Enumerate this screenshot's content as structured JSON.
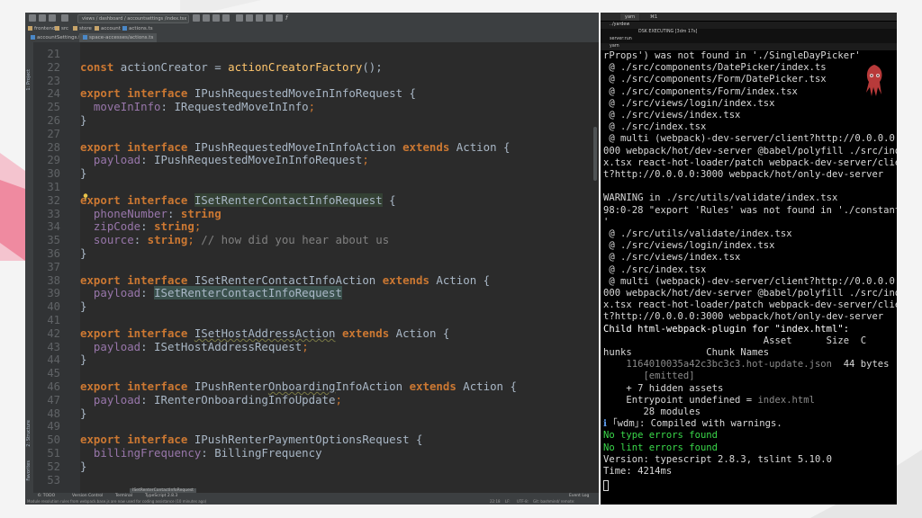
{
  "ide": {
    "toolbar_path": "views / dashboard / accountsettings /index.tsx",
    "breadcrumbs": [
      "frontend",
      "src",
      "store",
      "account",
      "actions.ts"
    ],
    "tabs": [
      "accountSettings.ts",
      "space-accesses/actions.ts"
    ],
    "side_tools": [
      "1: Project",
      "2: Structure",
      "Favorites"
    ],
    "gutter_start": 21,
    "status_top": "ISetRenterContactInfoRequest",
    "bottom_tools": [
      "6: TODO",
      "Version Control",
      "Terminal",
      "TypeScript 2.8.3"
    ],
    "event_log": "Event Log",
    "status_text": "Module resolution rules from webpack.base.js are now used for coding assistance (10 minutes ago)",
    "cursor_pos": "22:18",
    "line_sep": "LF:",
    "encoding": "UTF-8:",
    "git": "Git: bashmind/ remote:"
  },
  "code_lines": [
    [],
    [
      {
        "t": "const ",
        "c": "kw"
      },
      {
        "t": "actionCreator = "
      },
      {
        "t": "actionCreatorFactory",
        "c": "fn"
      },
      {
        "t": "();"
      }
    ],
    [],
    [
      {
        "t": "export ",
        "c": "kw"
      },
      {
        "t": "interface ",
        "c": "kw"
      },
      {
        "t": "IPushRequestedMoveInInfoRequest {"
      }
    ],
    [
      {
        "t": "  "
      },
      {
        "t": "moveInInfo",
        "c": "fld"
      },
      {
        "t": ": IRequestedMoveInInfo"
      },
      {
        "t": ";",
        "c": "punct"
      }
    ],
    [
      {
        "t": "}"
      }
    ],
    [],
    [
      {
        "t": "export ",
        "c": "kw"
      },
      {
        "t": "interface ",
        "c": "kw"
      },
      {
        "t": "IPushRequestedMoveInInfoAction "
      },
      {
        "t": "extends ",
        "c": "kw"
      },
      {
        "t": "Action {"
      }
    ],
    [
      {
        "t": "  "
      },
      {
        "t": "payload",
        "c": "fld"
      },
      {
        "t": ": IPushRequestedMoveInInfoRequest"
      },
      {
        "t": ";",
        "c": "punct"
      }
    ],
    [
      {
        "t": "}"
      }
    ],
    [],
    [
      {
        "t": "export ",
        "c": "kw"
      },
      {
        "t": "interface ",
        "c": "kw"
      },
      {
        "t": "ISetRenterContactInfoRequest",
        "c": "hl"
      },
      {
        "t": " {"
      }
    ],
    [
      {
        "t": "  "
      },
      {
        "t": "phoneNumber",
        "c": "fld"
      },
      {
        "t": ": "
      },
      {
        "t": "string",
        "c": "kw"
      }
    ],
    [
      {
        "t": "  "
      },
      {
        "t": "zipCode",
        "c": "fld"
      },
      {
        "t": ": "
      },
      {
        "t": "string",
        "c": "kw"
      },
      {
        "t": ";",
        "c": "punct"
      }
    ],
    [
      {
        "t": "  "
      },
      {
        "t": "source",
        "c": "fld"
      },
      {
        "t": ": "
      },
      {
        "t": "string",
        "c": "kw"
      },
      {
        "t": "; ",
        "c": "punct"
      },
      {
        "t": "// how did you hear about us",
        "c": "cm"
      }
    ],
    [
      {
        "t": "}"
      }
    ],
    [],
    [
      {
        "t": "export ",
        "c": "kw"
      },
      {
        "t": "interface ",
        "c": "kw"
      },
      {
        "t": "ISetRenterContactInfoAction "
      },
      {
        "t": "extends ",
        "c": "kw"
      },
      {
        "t": "Action {"
      }
    ],
    [
      {
        "t": "  "
      },
      {
        "t": "payload",
        "c": "fld"
      },
      {
        "t": ": "
      },
      {
        "t": "ISetRenterContactInfoRequest",
        "c": "hl2"
      }
    ],
    [
      {
        "t": "}"
      }
    ],
    [],
    [
      {
        "t": "export ",
        "c": "kw"
      },
      {
        "t": "interface ",
        "c": "kw"
      },
      {
        "t": "ISetHostAddressAction",
        "c": "und"
      },
      {
        "t": " "
      },
      {
        "t": "extends ",
        "c": "kw"
      },
      {
        "t": "Action {"
      }
    ],
    [
      {
        "t": "  "
      },
      {
        "t": "payload",
        "c": "fld"
      },
      {
        "t": ": ISetHostAddressRequest"
      },
      {
        "t": ";",
        "c": "punct"
      }
    ],
    [
      {
        "t": "}"
      }
    ],
    [],
    [
      {
        "t": "export ",
        "c": "kw"
      },
      {
        "t": "interface ",
        "c": "kw"
      },
      {
        "t": "IPushRenter"
      },
      {
        "t": "Onboarding",
        "c": "und"
      },
      {
        "t": "InfoAction "
      },
      {
        "t": "extends ",
        "c": "kw"
      },
      {
        "t": "Action {"
      }
    ],
    [
      {
        "t": "  "
      },
      {
        "t": "payload",
        "c": "fld"
      },
      {
        "t": ": IRenterOnboardingInfoUpdate"
      },
      {
        "t": ";",
        "c": "punct"
      }
    ],
    [
      {
        "t": "}"
      }
    ],
    [],
    [
      {
        "t": "export ",
        "c": "kw"
      },
      {
        "t": "interface ",
        "c": "kw"
      },
      {
        "t": "IPushRenterPaymentOptionsRequest {"
      }
    ],
    [
      {
        "t": "  "
      },
      {
        "t": "billingFrequency",
        "c": "fld"
      },
      {
        "t": ": BillingFrequency"
      }
    ],
    [
      {
        "t": "}"
      }
    ],
    []
  ],
  "terminal": {
    "tabs": [
      "yarn",
      "⌘1"
    ],
    "sub1": "../yardew",
    "sub2": "DSK EXECUTING [3dm 17s]",
    "sub3": "server:run",
    "sub4": "yarn",
    "lines": [
      {
        "t": "rProps') was not found in './SingleDayPicker'"
      },
      {
        "t": " @ ./src/components/DatePicker/index.ts"
      },
      {
        "t": " @ ./src/components/Form/DatePicker.tsx"
      },
      {
        "t": " @ ./src/components/Form/index.tsx"
      },
      {
        "t": " @ ./src/views/login/index.tsx"
      },
      {
        "t": " @ ./src/views/index.tsx"
      },
      {
        "t": " @ ./src/index.tsx"
      },
      {
        "t": " @ multi (webpack)-dev-server/client?http://0.0.0.0:3"
      },
      {
        "t": "000 webpack/hot/dev-server @babel/polyfill ./src/inde"
      },
      {
        "t": "x.tsx react-hot-loader/patch webpack-dev-server/clien"
      },
      {
        "t": "t?http://0.0.0.0:3000 webpack/hot/only-dev-server"
      },
      {
        "t": ""
      },
      {
        "t": "WARNING in ./src/utils/validate/index.tsx"
      },
      {
        "t": "98:0-28 \"export 'Rules' was not found in './constants"
      },
      {
        "t": "'"
      },
      {
        "t": " @ ./src/utils/validate/index.tsx"
      },
      {
        "t": " @ ./src/views/login/index.tsx"
      },
      {
        "t": " @ ./src/views/index.tsx"
      },
      {
        "t": " @ ./src/index.tsx"
      },
      {
        "t": " @ multi (webpack)-dev-server/client?http://0.0.0.0:3"
      },
      {
        "t": "000 webpack/hot/dev-server @babel/polyfill ./src/inde"
      },
      {
        "t": "x.tsx react-hot-loader/patch webpack-dev-server/clien"
      },
      {
        "t": "t?http://0.0.0.0:3000 webpack/hot/only-dev-server"
      },
      {
        "t": "Child html-webpack-plugin for \"index.html\":",
        "c": "bright"
      },
      {
        "t": "                            Asset      Size  C"
      },
      {
        "t": "hunks             Chunk Names"
      },
      {
        "t": "    1164010035a42c3bc3c3.hot-update.json  44 bytes",
        "c": "mix1"
      },
      {
        "t": "       [emitted]",
        "c": "gray"
      },
      {
        "t": "    + 7 hidden assets"
      },
      {
        "t": "    Entrypoint undefined = index.html",
        "c": "mix2"
      },
      {
        "t": "       28 modules"
      },
      {
        "t": "ℹ ｢wdm｣: Compiled with warnings.",
        "c": "mix3"
      },
      {
        "t": "No type errors found",
        "c": "green"
      },
      {
        "t": "No lint errors found",
        "c": "green"
      },
      {
        "t": "Version: typescript 2.8.3, tslint 5.10.0"
      },
      {
        "t": "Time: 4214ms"
      }
    ]
  }
}
